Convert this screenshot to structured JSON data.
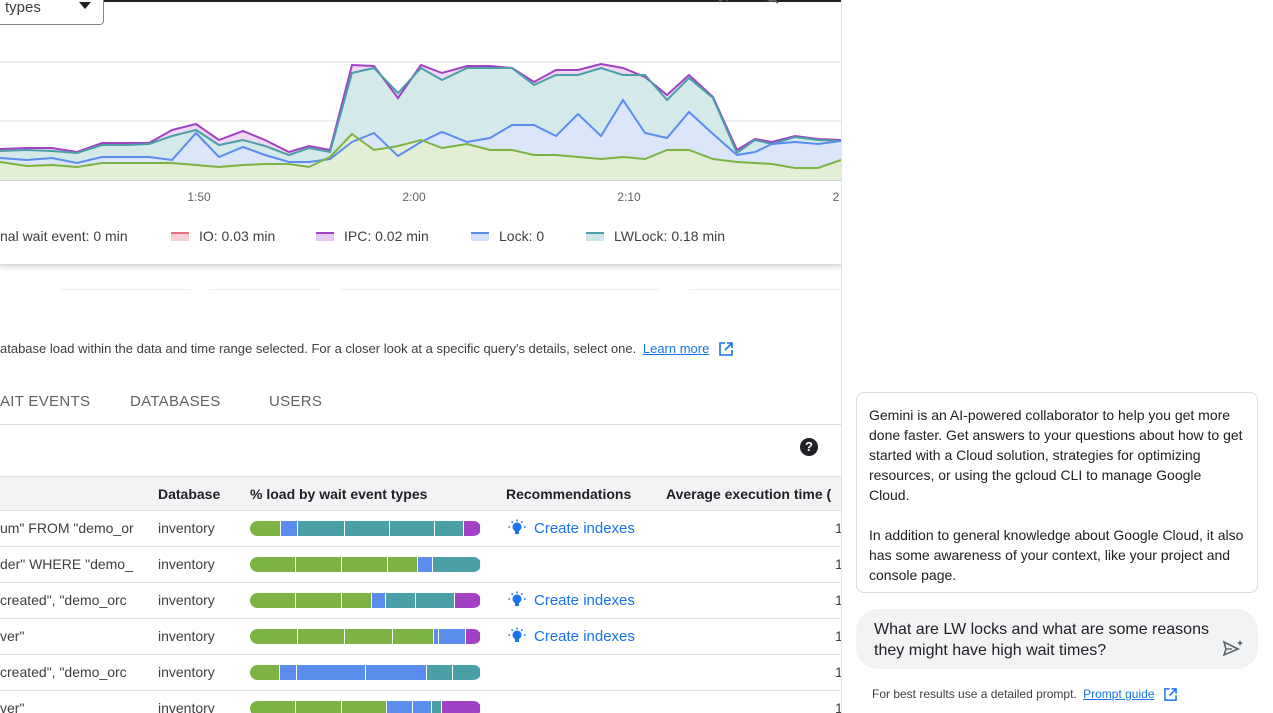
{
  "toolbar": {
    "filter_value": "types"
  },
  "chart_data": {
    "type": "area",
    "x_tick_labels": [
      "1:50",
      "2:00",
      "2:10",
      "2"
    ],
    "series": [
      {
        "name": "IO: 0.03 min",
        "color": "#e8707f"
      },
      {
        "name": "IPC: 0.02 min",
        "color": "#a142c4"
      },
      {
        "name": "Lock: 0",
        "color": "#5b8def"
      },
      {
        "name": "LWLock: 0.18 min",
        "color": "#4a9fa8"
      }
    ],
    "legend_partial": "nal wait event: 0 min",
    "legend_placement": "bottom",
    "grid": true
  },
  "description": {
    "text": "atabase load within the data and time range selected. For a closer look at a specific query's details, select one.",
    "learn_more": "Learn more"
  },
  "tabs": [
    "AIT EVENTS",
    "DATABASES",
    "USERS"
  ],
  "table": {
    "columns": [
      "Database",
      "% load by wait event types",
      "Recommendations",
      "Average execution time ("
    ],
    "rows": [
      {
        "query": "um\" FROM \"demo_or",
        "database": "inventory",
        "load": [
          13,
          7,
          20,
          19,
          19,
          12,
          7
        ],
        "recommendation": "Create indexes",
        "avg": "1"
      },
      {
        "query": "der\" WHERE \"demo_",
        "database": "inventory",
        "load": [
          20,
          20,
          20,
          13,
          6,
          21
        ],
        "recommendation": "",
        "avg": "1"
      },
      {
        "query": "created\", \"demo_orc",
        "database": "inventory",
        "load": [
          20,
          20,
          13,
          6,
          13,
          17,
          11
        ],
        "recommendation": "Create indexes",
        "avg": "1"
      },
      {
        "query": "ver\"",
        "database": "inventory",
        "load": [
          20,
          20,
          20,
          17,
          2,
          11,
          6
        ],
        "recommendation": "Create indexes",
        "avg": "1"
      },
      {
        "query": "created\", \"demo_orc",
        "database": "inventory",
        "load": [
          13,
          7,
          30,
          27,
          11,
          12
        ],
        "recommendation": "",
        "avg": "1"
      },
      {
        "query": "ver\"",
        "database": "inventory",
        "load": [
          20,
          20,
          20,
          11,
          8,
          4,
          17
        ],
        "recommendation": "",
        "avg": "1"
      }
    ]
  },
  "gemini": {
    "intro_p1": "Gemini is an AI-powered collaborator to help you get more done faster. Get answers to your questions about how to get started with a Cloud solution, strategies for optimizing resources, or using the gcloud CLI to manage Google Cloud.",
    "intro_p2": "In addition to general knowledge about Google Cloud, it also has some awareness of your context, like your project and console page.",
    "prompt": "What are LW locks and what are some reasons they might have high wait times?",
    "hint": "For best results use a detailed prompt.",
    "prompt_guide": "Prompt guide"
  },
  "colors": {
    "green": "#7cb342",
    "blue": "#5b8def",
    "teal": "#4a9fa8",
    "purple": "#a142c4",
    "link": "#1a73e8"
  }
}
